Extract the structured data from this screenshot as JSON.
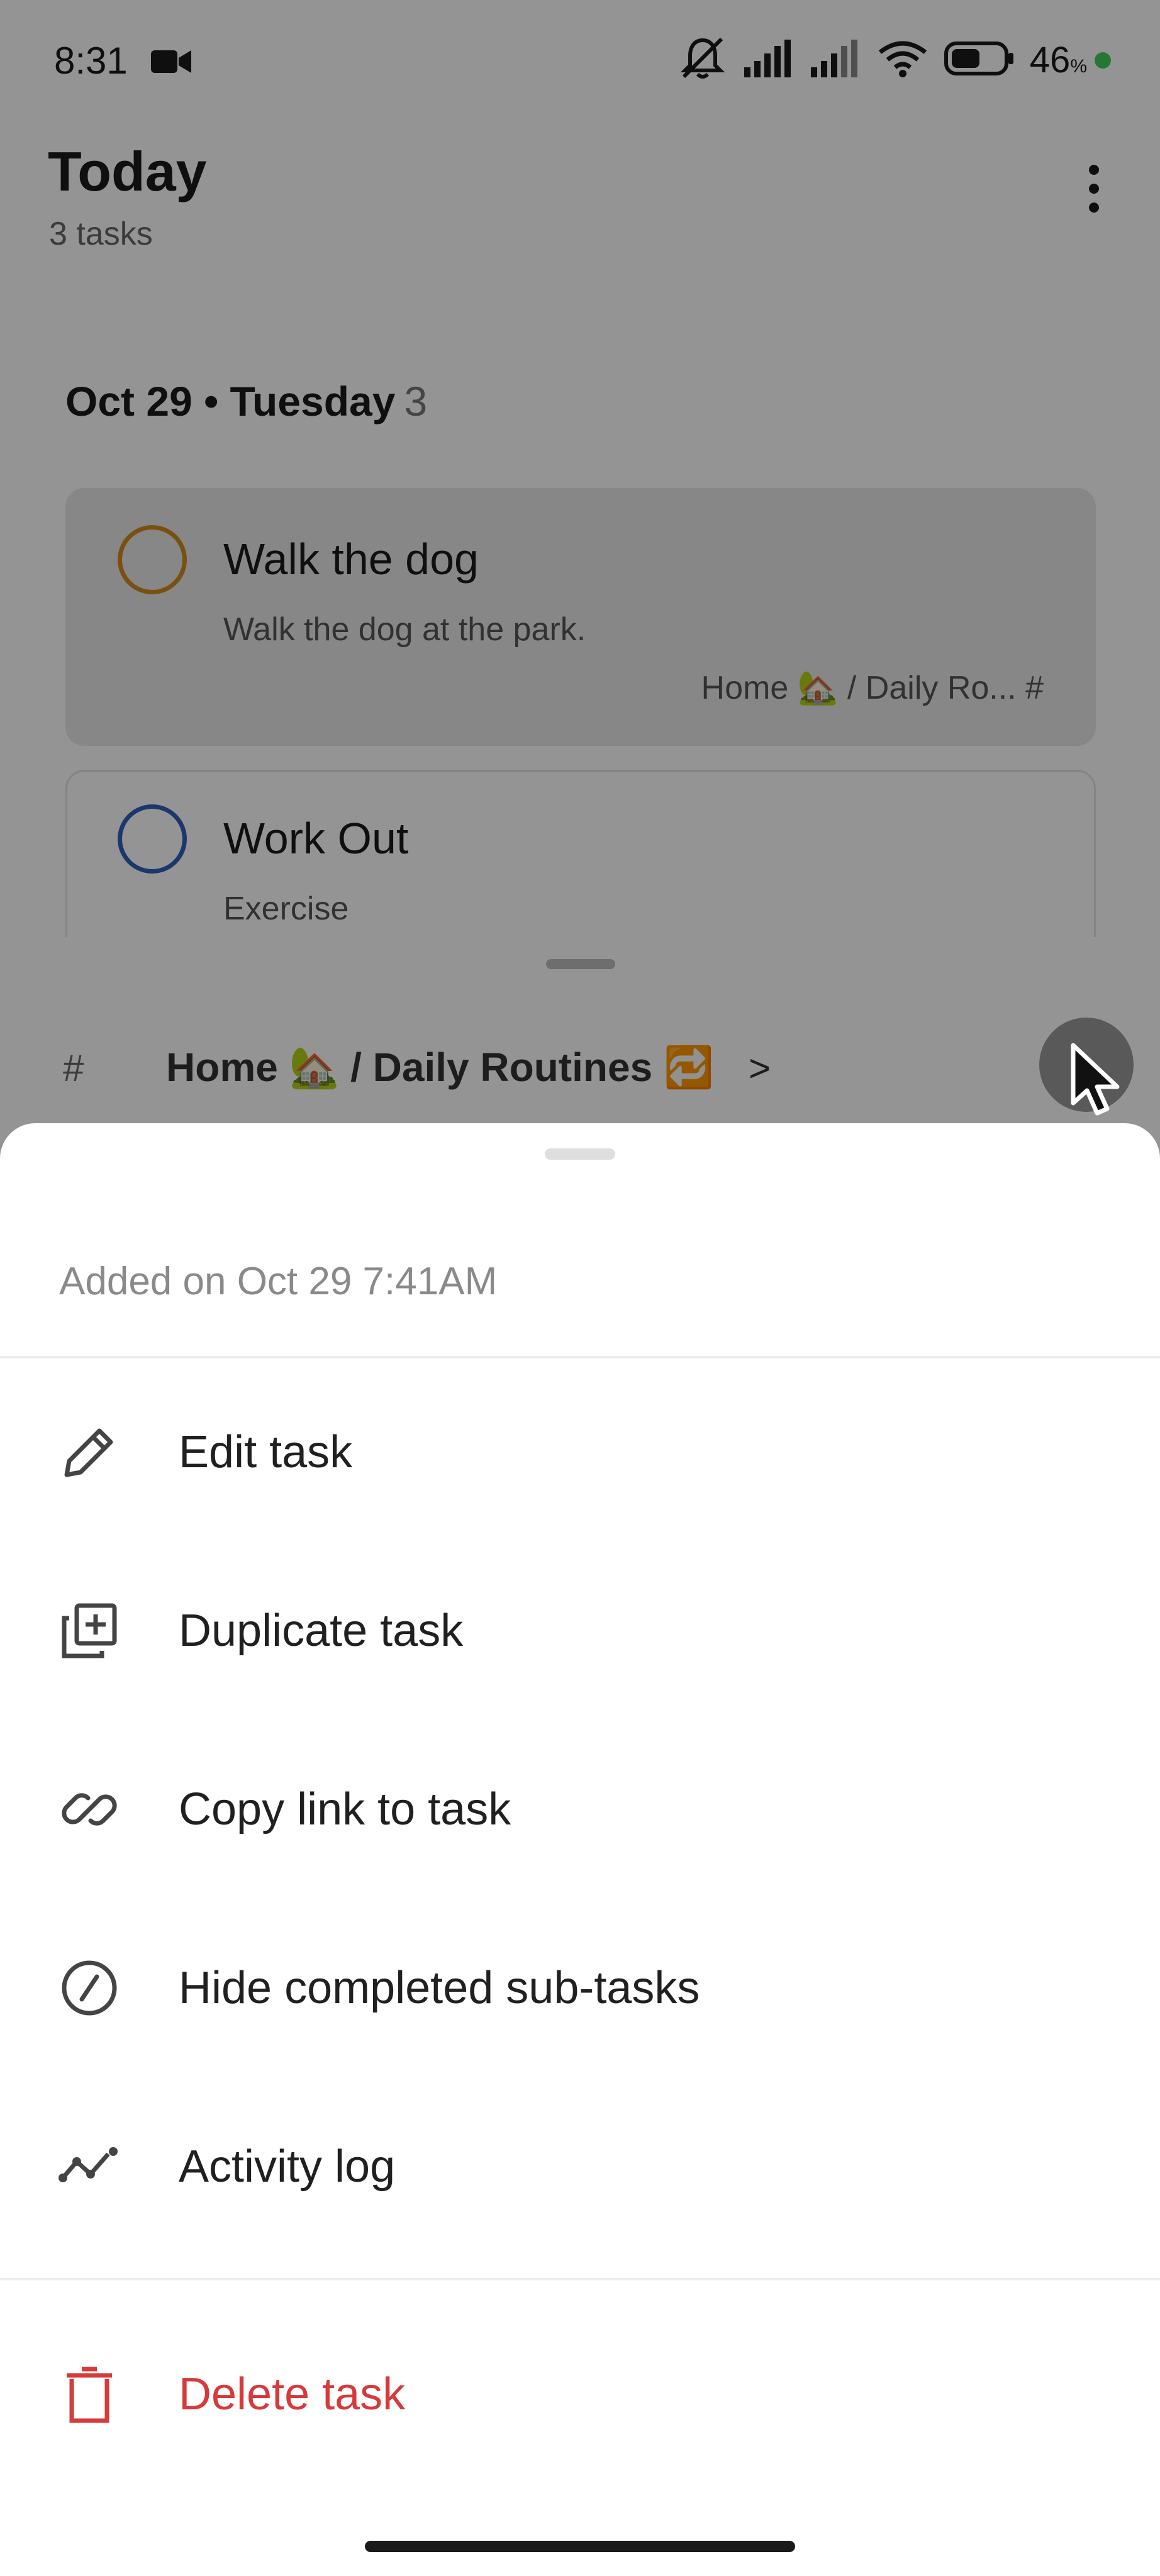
{
  "status_bar": {
    "time": "8:31",
    "battery": "46",
    "battery_unit": "%"
  },
  "header": {
    "title": "Today",
    "subtitle": "3 tasks"
  },
  "section": {
    "date": "Oct 29 • Tuesday",
    "count": "3"
  },
  "tasks": [
    {
      "title": "Walk the dog",
      "description": "Walk the dog at the park.",
      "project": "Home 🏡 / Daily Ro... #",
      "circle_color": "#d08a1c"
    },
    {
      "title": "Work Out",
      "description": "Exercise",
      "circle_color": "#2f5fb8"
    }
  ],
  "task_detail_bar": {
    "hash": "#",
    "path": "Home 🏡 / Daily Routines 🔁",
    "chevron": ">"
  },
  "sheet": {
    "added_text": "Added on Oct 29 7:41AM",
    "items": [
      {
        "label": "Edit task",
        "icon": "pencil-icon"
      },
      {
        "label": "Duplicate task",
        "icon": "duplicate-icon"
      },
      {
        "label": "Copy link to task",
        "icon": "link-icon"
      },
      {
        "label": "Hide completed sub-tasks",
        "icon": "hide-circle-icon"
      },
      {
        "label": "Activity log",
        "icon": "activity-icon"
      }
    ],
    "delete": {
      "label": "Delete task",
      "icon": "trash-icon",
      "color": "#d63a3a"
    }
  }
}
